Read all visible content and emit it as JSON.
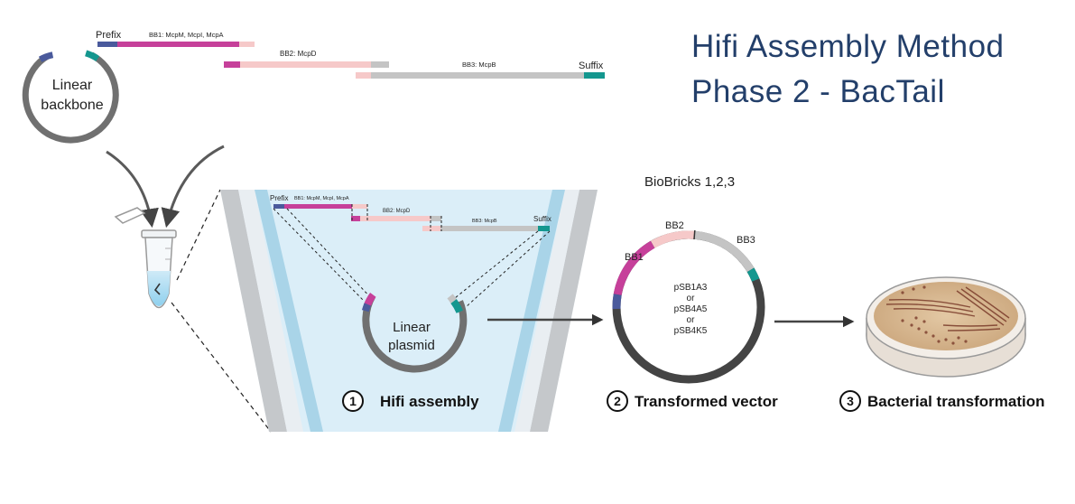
{
  "title": {
    "line1": "Hifi Assembly Method",
    "line2": "Phase 2 - BacTail"
  },
  "top_fragments": {
    "prefix": "Prefix",
    "bb1": "BB1: McpM, McpI, McpA",
    "bb2": "BB2: McpD",
    "bb3": "BB3: McpB",
    "suffix": "Suffix"
  },
  "linear_backbone": {
    "line1": "Linear",
    "line2": "backbone"
  },
  "biobricks_label": "BioBricks 1,2,3",
  "inset_fragments": {
    "prefix": "Prefix",
    "bb1": "BB1: McpM, McpI, McpA",
    "bb2": "BB2: McpD",
    "bb3": "BB3: McpB",
    "suffix": "Suffix"
  },
  "linear_plasmid": {
    "line1": "Linear",
    "line2": "plasmid"
  },
  "vector": {
    "bb1": "BB1",
    "bb2": "BB2",
    "bb3": "BB3",
    "options": [
      "pSB1A3",
      "or",
      "pSB4A5",
      "or",
      "pSB4K5"
    ]
  },
  "steps": [
    {
      "num": "1",
      "label": "Hifi assembly"
    },
    {
      "num": "2",
      "label": "Transformed vector"
    },
    {
      "num": "3",
      "label": "Bacterial transformation"
    }
  ],
  "colors": {
    "title": "#233f6a",
    "bb1": "#c6409a",
    "bb2": "#f6c9c9",
    "bb3": "#c4c4c4",
    "prefix": "#4a5a9c",
    "suffix": "#14978f",
    "backbone": "#707070",
    "vector": "#444444"
  }
}
